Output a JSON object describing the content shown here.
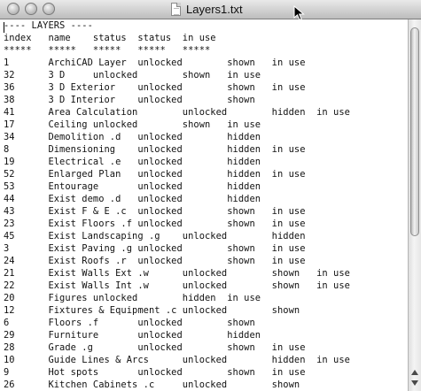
{
  "window": {
    "title": "Layers1.txt"
  },
  "document": {
    "lines": [
      "---- LAYERS ----",
      "index   name    status  status  in use",
      "*****   *****   *****   *****   *****",
      "",
      "1       ArchiCAD Layer  unlocked        shown   in use",
      "32      3 D     unlocked        shown   in use",
      "36      3 D Exterior    unlocked        shown   in use",
      "38      3 D Interior    unlocked        shown",
      "41      Area Calculation        unlocked        hidden  in use",
      "17      Ceiling unlocked        shown   in use",
      "34      Demolition .d   unlocked        hidden",
      "8       Dimensioning    unlocked        hidden  in use",
      "19      Electrical .e   unlocked        hidden",
      "52      Enlarged Plan   unlocked        hidden  in use",
      "53      Entourage       unlocked        hidden",
      "44      Exist demo .d   unlocked        hidden",
      "43      Exist F & E .c  unlocked        shown   in use",
      "23      Exist Floors .f unlocked        shown   in use",
      "45      Exist Landscaping .g    unlocked        hidden",
      "3       Exist Paving .g unlocked        shown   in use",
      "24      Exist Roofs .r  unlocked        shown   in use",
      "21      Exist Walls Ext .w      unlocked        shown   in use",
      "22      Exist Walls Int .w      unlocked        shown   in use",
      "20      Figures unlocked        hidden  in use",
      "12      Fixtures & Equipment .c unlocked        shown",
      "6       Floors .f       unlocked        shown",
      "29      Furniture       unlocked        hidden",
      "28      Grade .g        unlocked        shown   in use",
      "10      Guide Lines & Arcs      unlocked        hidden  in use",
      "9       Hot spots       unlocked        shown   in use",
      "26      Kitchen Cabinets .c     unlocked        shown"
    ]
  }
}
